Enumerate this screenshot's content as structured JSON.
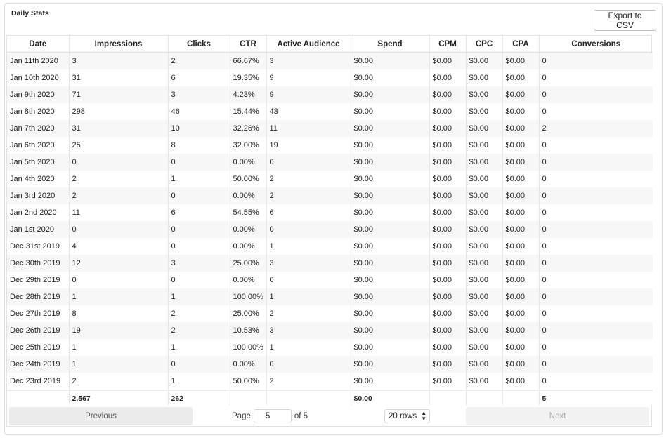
{
  "panel": {
    "title": "Daily Stats",
    "export_label": "Export to CSV"
  },
  "table": {
    "columns": [
      "Date",
      "Impressions",
      "Clicks",
      "CTR",
      "Active Audience",
      "Spend",
      "CPM",
      "CPC",
      "CPA",
      "Conversions"
    ],
    "rows": [
      [
        "Jan 11th 2020",
        "3",
        "2",
        "66.67%",
        "3",
        "$0.00",
        "$0.00",
        "$0.00",
        "$0.00",
        "0"
      ],
      [
        "Jan 10th 2020",
        "31",
        "6",
        "19.35%",
        "9",
        "$0.00",
        "$0.00",
        "$0.00",
        "$0.00",
        "0"
      ],
      [
        "Jan 9th 2020",
        "71",
        "3",
        "4.23%",
        "9",
        "$0.00",
        "$0.00",
        "$0.00",
        "$0.00",
        "0"
      ],
      [
        "Jan 8th 2020",
        "298",
        "46",
        "15.44%",
        "43",
        "$0.00",
        "$0.00",
        "$0.00",
        "$0.00",
        "0"
      ],
      [
        "Jan 7th 2020",
        "31",
        "10",
        "32.26%",
        "11",
        "$0.00",
        "$0.00",
        "$0.00",
        "$0.00",
        "2"
      ],
      [
        "Jan 6th 2020",
        "25",
        "8",
        "32.00%",
        "19",
        "$0.00",
        "$0.00",
        "$0.00",
        "$0.00",
        "0"
      ],
      [
        "Jan 5th 2020",
        "0",
        "0",
        "0.00%",
        "0",
        "$0.00",
        "$0.00",
        "$0.00",
        "$0.00",
        "0"
      ],
      [
        "Jan 4th 2020",
        "2",
        "1",
        "50.00%",
        "2",
        "$0.00",
        "$0.00",
        "$0.00",
        "$0.00",
        "0"
      ],
      [
        "Jan 3rd 2020",
        "2",
        "0",
        "0.00%",
        "2",
        "$0.00",
        "$0.00",
        "$0.00",
        "$0.00",
        "0"
      ],
      [
        "Jan 2nd 2020",
        "11",
        "6",
        "54.55%",
        "6",
        "$0.00",
        "$0.00",
        "$0.00",
        "$0.00",
        "0"
      ],
      [
        "Jan 1st 2020",
        "0",
        "0",
        "0.00%",
        "0",
        "$0.00",
        "$0.00",
        "$0.00",
        "$0.00",
        "0"
      ],
      [
        "Dec 31st 2019",
        "4",
        "0",
        "0.00%",
        "1",
        "$0.00",
        "$0.00",
        "$0.00",
        "$0.00",
        "0"
      ],
      [
        "Dec 30th 2019",
        "12",
        "3",
        "25.00%",
        "3",
        "$0.00",
        "$0.00",
        "$0.00",
        "$0.00",
        "0"
      ],
      [
        "Dec 29th 2019",
        "0",
        "0",
        "0.00%",
        "0",
        "$0.00",
        "$0.00",
        "$0.00",
        "$0.00",
        "0"
      ],
      [
        "Dec 28th 2019",
        "1",
        "1",
        "100.00%",
        "1",
        "$0.00",
        "$0.00",
        "$0.00",
        "$0.00",
        "0"
      ],
      [
        "Dec 27th 2019",
        "8",
        "2",
        "25.00%",
        "2",
        "$0.00",
        "$0.00",
        "$0.00",
        "$0.00",
        "0"
      ],
      [
        "Dec 26th 2019",
        "19",
        "2",
        "10.53%",
        "3",
        "$0.00",
        "$0.00",
        "$0.00",
        "$0.00",
        "0"
      ],
      [
        "Dec 25th 2019",
        "1",
        "1",
        "100.00%",
        "1",
        "$0.00",
        "$0.00",
        "$0.00",
        "$0.00",
        "0"
      ],
      [
        "Dec 24th 2019",
        "1",
        "0",
        "0.00%",
        "0",
        "$0.00",
        "$0.00",
        "$0.00",
        "$0.00",
        "0"
      ],
      [
        "Dec 23rd 2019",
        "2",
        "1",
        "50.00%",
        "2",
        "$0.00",
        "$0.00",
        "$0.00",
        "$0.00",
        "0"
      ]
    ],
    "totals": [
      "",
      "2,567",
      "262",
      "",
      "",
      "$0.00",
      "",
      "",
      "",
      "5"
    ]
  },
  "pagination": {
    "previous_label": "Previous",
    "next_label": "Next",
    "page_label": "Page",
    "page_value": "5",
    "of_label": "of 5",
    "rows_label": "20 rows"
  },
  "colors": {
    "stripe": "#f7f7f7",
    "border": "#e2e2e2",
    "button_bg": "#ebebeb"
  }
}
